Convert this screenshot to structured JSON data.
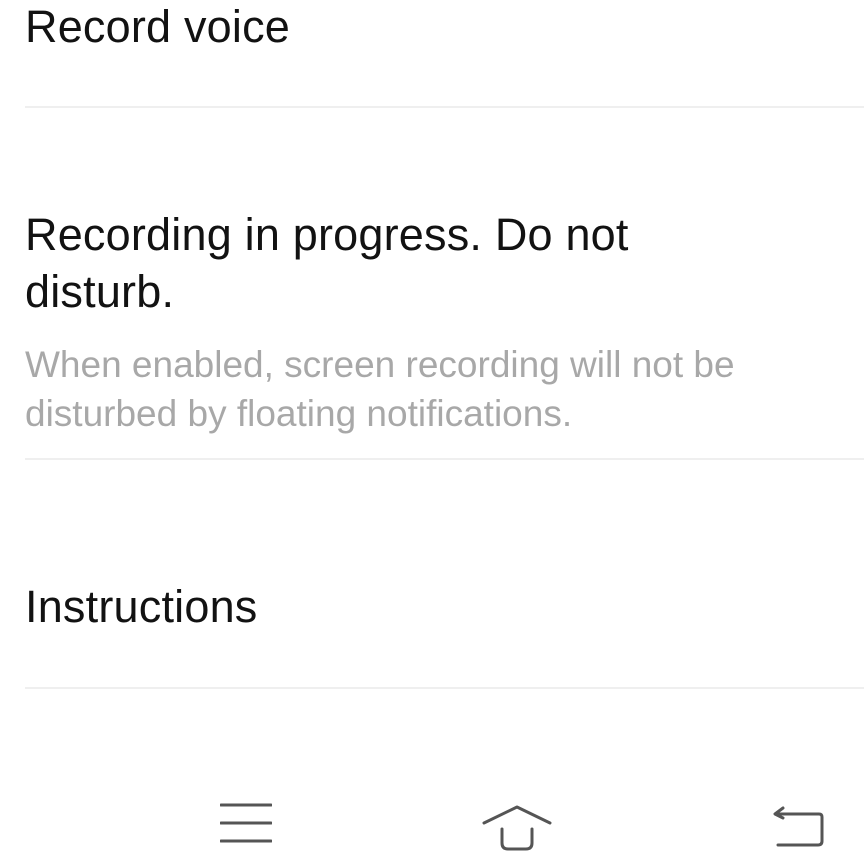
{
  "settings": {
    "record_voice": {
      "title": "Record voice"
    },
    "do_not_disturb": {
      "title": "Recording in progress. Do not disturb.",
      "description": "When enabled, screen recording will not be disturbed by floating notifications."
    },
    "instructions": {
      "title": "Instructions"
    }
  },
  "navigation": {
    "buttons": [
      "menu-icon",
      "home-icon",
      "back-icon"
    ]
  },
  "colors": {
    "background": "#ffffff",
    "title_text": "#121212",
    "description_text": "#a8a8a8",
    "divider": "#efefef",
    "nav_icon": "#555555"
  }
}
